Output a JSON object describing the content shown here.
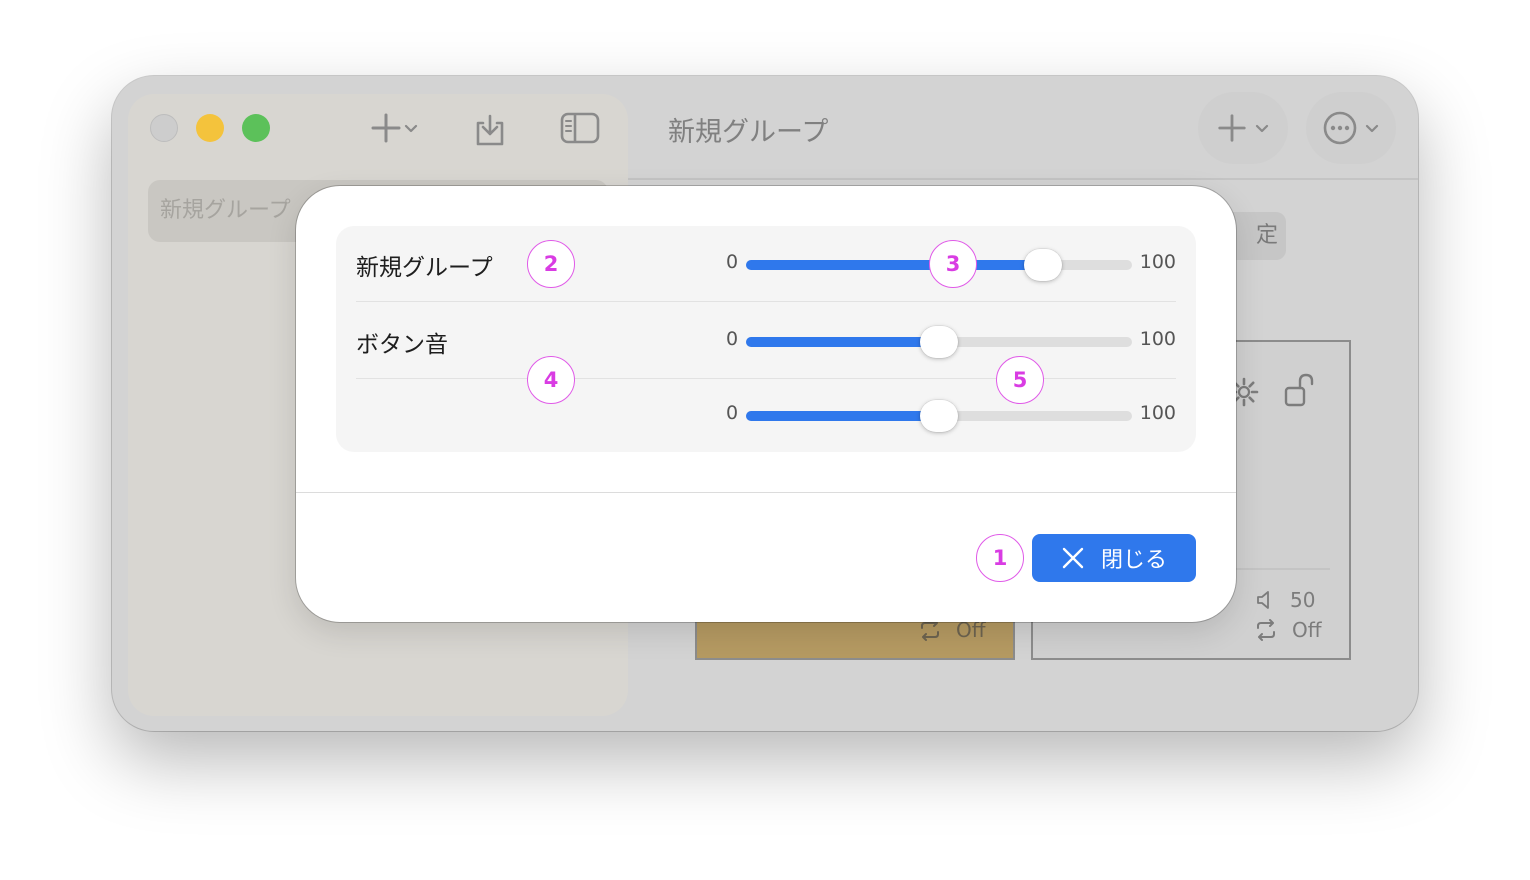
{
  "window": {
    "title": "新規グループ",
    "sidebar_search_text": "新規グループ",
    "settings_chip_text": "定"
  },
  "cards": {
    "left_stat_text": "Off",
    "right_volume_text": "50",
    "right_repeat_text": "Off"
  },
  "modal": {
    "rows": [
      {
        "label": "新規グループ",
        "slider": {
          "min_label": "0",
          "max_label": "100",
          "value_fraction": 0.77
        }
      },
      {
        "label": "ボタン音",
        "slider": {
          "min_label": "0",
          "max_label": "100",
          "value_fraction": 0.5
        }
      },
      {
        "label": "",
        "slider": {
          "min_label": "0",
          "max_label": "100",
          "value_fraction": 0.5
        }
      }
    ],
    "close_button_label": "閉じる"
  },
  "badges": [
    "1",
    "2",
    "3",
    "4",
    "5"
  ],
  "colors": {
    "accent": "#2f78ec",
    "badge": "#d93ce3",
    "traffic_min": "#f4c33c",
    "traffic_max": "#5cc15a",
    "card_left": "#b59a62"
  },
  "icons": {
    "toolbar": [
      "plus-icon",
      "chevron-down-icon",
      "download-tray-icon",
      "sidebar-toggle-icon",
      "ellipsis-circle-icon"
    ],
    "cards": [
      "gear-icon",
      "unlock-icon",
      "speaker-icon",
      "repeat-icon"
    ],
    "close_button": "close-x-icon"
  }
}
